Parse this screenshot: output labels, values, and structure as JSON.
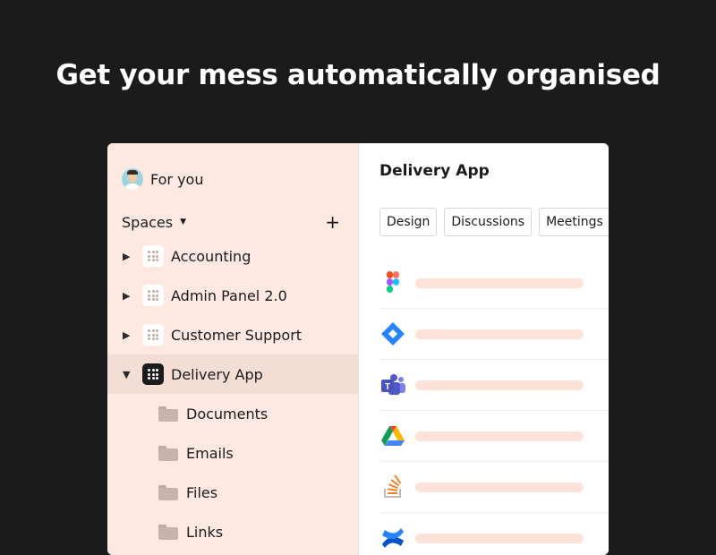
{
  "headline": "Get your mess automatically organised",
  "sidebar": {
    "for_you": "For you",
    "spaces_label": "Spaces",
    "spaces": [
      {
        "label": "Accounting",
        "expanded": false
      },
      {
        "label": "Admin Panel 2.0",
        "expanded": false
      },
      {
        "label": "Customer Support",
        "expanded": false
      },
      {
        "label": "Delivery App",
        "expanded": true,
        "selected": true
      }
    ],
    "folders": [
      "Documents",
      "Emails",
      "Files",
      "Links"
    ]
  },
  "main": {
    "title": "Delivery App",
    "tabs": [
      "Design",
      "Discussions",
      "Meetings"
    ],
    "rows": [
      {
        "icon": "figma-icon"
      },
      {
        "icon": "jira-icon"
      },
      {
        "icon": "teams-icon"
      },
      {
        "icon": "google-drive-icon"
      },
      {
        "icon": "stackoverflow-icon"
      },
      {
        "icon": "confluence-icon"
      }
    ]
  },
  "colors": {
    "background": "#1c1b1b",
    "sidebar": "#fde9e2",
    "selected": "#f3ded6",
    "placeholder_bar": "#fde2d9"
  }
}
